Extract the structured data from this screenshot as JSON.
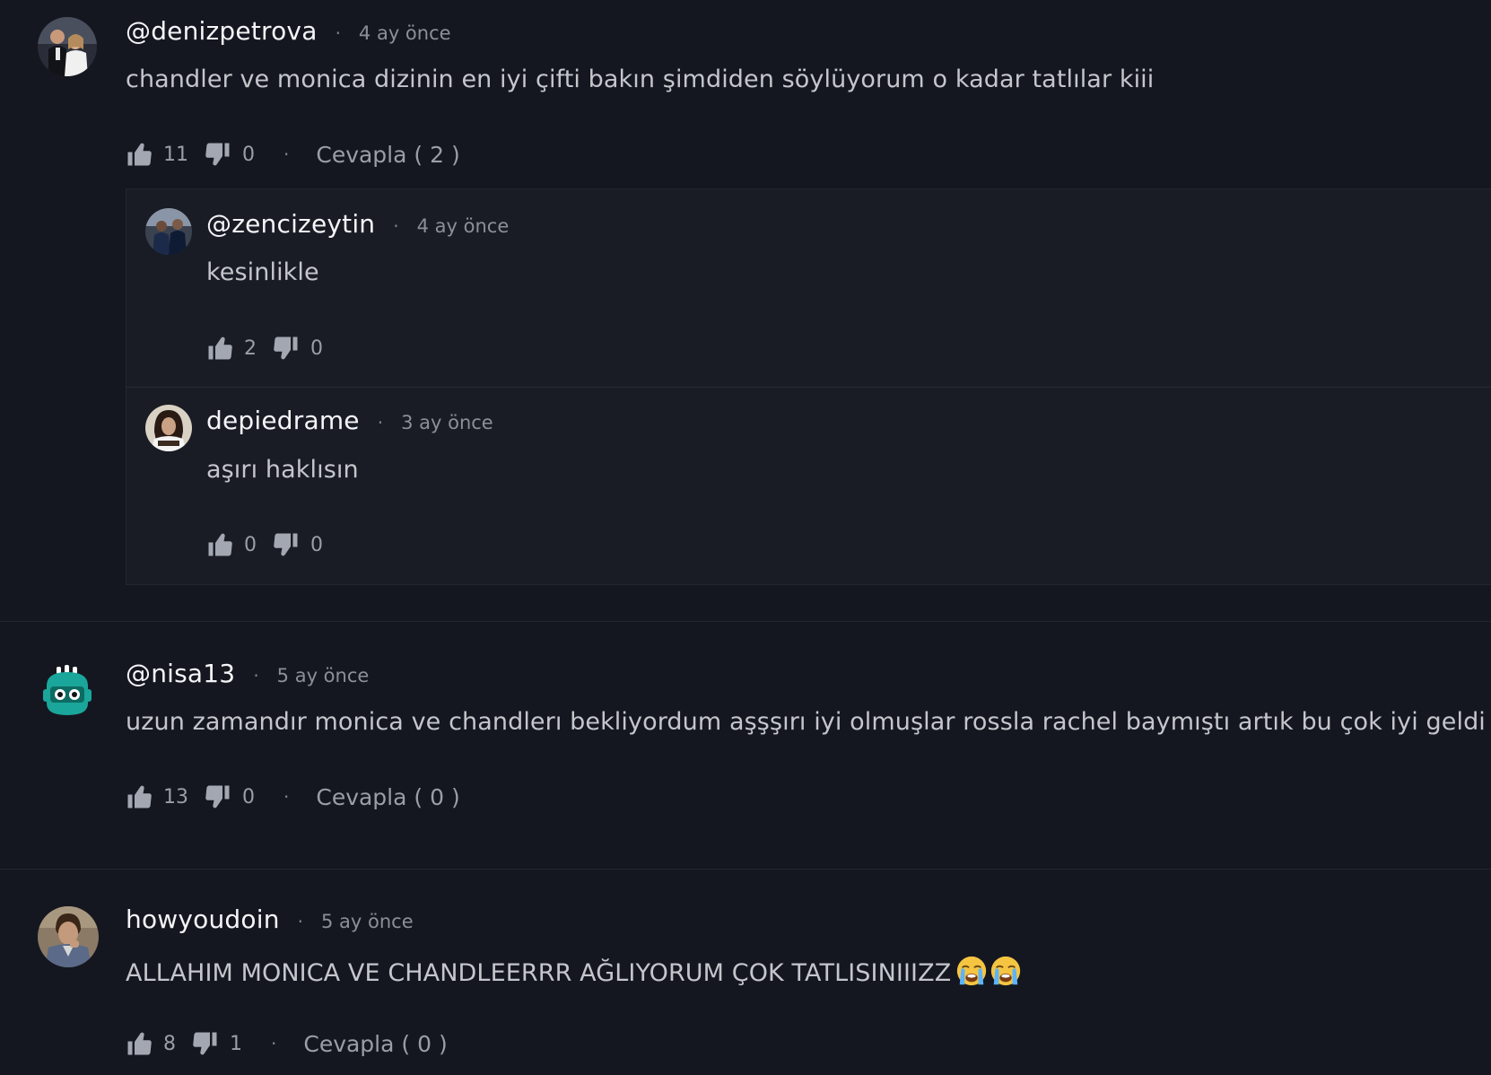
{
  "comments": [
    {
      "username": "@denizpetrova",
      "time": "4 ay önce",
      "text": "chandler ve monica dizinin en iyi çifti bakın şimdiden söylüyorum o kadar tatlılar kiii",
      "likes": "11",
      "dislikes": "0",
      "reply_label": "Cevapla ( 2 )",
      "avatar_icon": "couple-photo-avatar",
      "replies": [
        {
          "username": "@zencizeytin",
          "time": "4 ay önce",
          "text": "kesinlikle",
          "likes": "2",
          "dislikes": "0",
          "avatar_icon": "people-photo-avatar"
        },
        {
          "username": "depiedrame",
          "time": "3 ay önce",
          "text": "aşırı haklısın",
          "likes": "0",
          "dislikes": "0",
          "avatar_icon": "woman-photo-avatar"
        }
      ]
    },
    {
      "username": "@nisa13",
      "time": "5 ay önce",
      "text": "uzun zamandır monica ve chandlerı bekliyordum aşşşırı iyi olmuşlar rossla rachel baymıştı artık bu çok iyi geldi",
      "likes": "13",
      "dislikes": "0",
      "reply_label": "Cevapla ( 0 )",
      "avatar_icon": "robot-avatar"
    },
    {
      "username": "howyoudoin",
      "time": "5 ay önce",
      "text": "ALLAHIM MONICA VE CHANDLEERRR AĞLIYORUM ÇOK TATLISINIIIZZ",
      "emoji": [
        "loudly-crying-face-emoji",
        "loudly-crying-face-emoji"
      ],
      "likes": "8",
      "dislikes": "1",
      "reply_label": "Cevapla ( 0 )",
      "avatar_icon": "man-photo-avatar"
    }
  ],
  "colors": {
    "background": "#151720",
    "reply_background": "#1a1c25",
    "username": "#f4f5f8",
    "text": "#c4c6cc",
    "muted": "#9a9ea8",
    "icon": "#a3a7b1",
    "robot_teal": "#1aa69a"
  }
}
